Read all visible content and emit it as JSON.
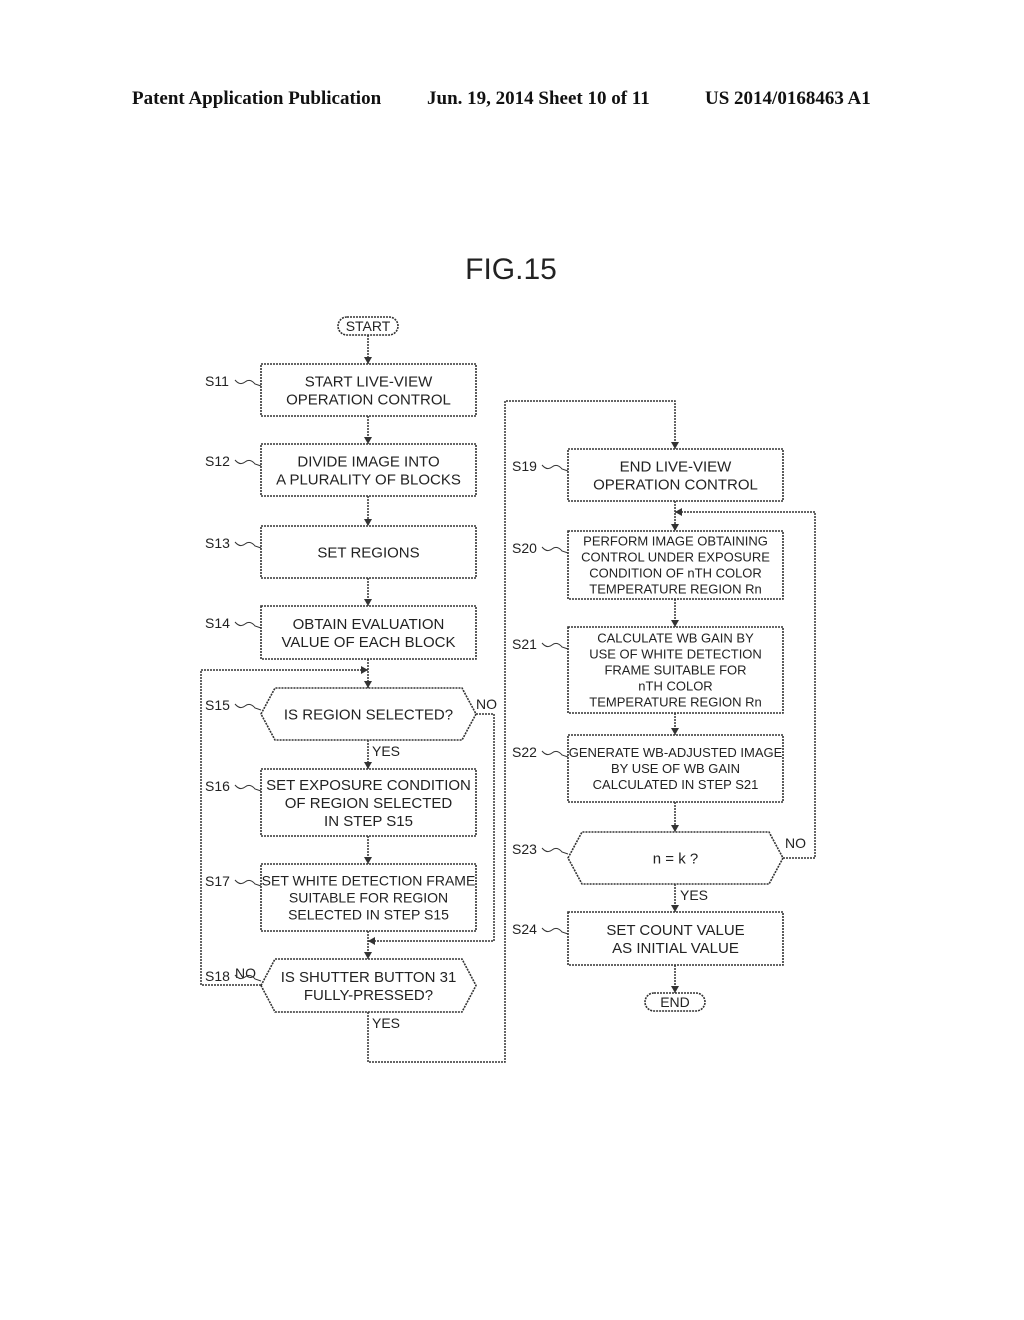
{
  "header": {
    "publication": "Patent Application Publication",
    "date_sheet": "Jun. 19, 2014  Sheet 10 of 11",
    "number": "US 2014/0168463 A1"
  },
  "figure": {
    "title": "FIG.15",
    "start": "START",
    "end": "END",
    "steps": [
      {
        "id": "S11",
        "type": "process",
        "lines": [
          "START LIVE-VIEW",
          "OPERATION CONTROL"
        ]
      },
      {
        "id": "S12",
        "type": "process",
        "lines": [
          "DIVIDE IMAGE INTO",
          "A PLURALITY OF BLOCKS"
        ]
      },
      {
        "id": "S13",
        "type": "process",
        "lines": [
          "SET REGIONS"
        ]
      },
      {
        "id": "S14",
        "type": "process",
        "lines": [
          "OBTAIN EVALUATION",
          "VALUE OF EACH BLOCK"
        ]
      },
      {
        "id": "S15",
        "type": "decision",
        "lines": [
          "IS REGION SELECTED?"
        ]
      },
      {
        "id": "S16",
        "type": "process",
        "lines": [
          "SET EXPOSURE CONDITION",
          "OF REGION SELECTED",
          "IN STEP S15"
        ]
      },
      {
        "id": "S17",
        "type": "process",
        "lines": [
          "SET WHITE DETECTION FRAME",
          "SUITABLE FOR REGION",
          "SELECTED IN STEP S15"
        ]
      },
      {
        "id": "S18",
        "type": "decision",
        "lines": [
          "IS SHUTTER BUTTON 31",
          "FULLY-PRESSED?"
        ]
      },
      {
        "id": "S19",
        "type": "process",
        "lines": [
          "END LIVE-VIEW",
          "OPERATION CONTROL"
        ]
      },
      {
        "id": "S20",
        "type": "process",
        "lines": [
          "PERFORM IMAGE OBTAINING",
          "CONTROL UNDER EXPOSURE",
          "CONDITION OF nTH COLOR",
          "TEMPERATURE REGION Rn"
        ]
      },
      {
        "id": "S21",
        "type": "process",
        "lines": [
          "CALCULATE WB GAIN BY",
          "USE OF WHITE DETECTION",
          "FRAME SUITABLE FOR",
          "nTH COLOR",
          "TEMPERATURE REGION Rn"
        ]
      },
      {
        "id": "S22",
        "type": "process",
        "lines": [
          "GENERATE WB-ADJUSTED IMAGE",
          "BY USE OF WB GAIN",
          "CALCULATED IN STEP S21"
        ]
      },
      {
        "id": "S23",
        "type": "decision",
        "lines": [
          "n = k ?"
        ]
      },
      {
        "id": "S24",
        "type": "process",
        "lines": [
          "SET COUNT VALUE",
          "AS INITIAL VALUE"
        ]
      }
    ],
    "branch_labels": {
      "s15_yes": "YES",
      "s15_no": "NO",
      "s18_yes": "YES",
      "s18_no": "NO",
      "s23_yes": "YES",
      "s23_no": "NO"
    }
  }
}
